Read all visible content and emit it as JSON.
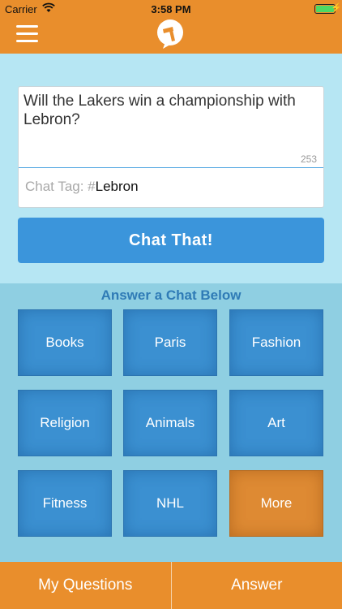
{
  "status_bar": {
    "carrier": "Carrier",
    "time": "3:58 PM",
    "battery_level": 1.0
  },
  "header": {
    "menu_icon": "hamburger-icon",
    "logo_icon": "chat-hammer-logo-icon"
  },
  "composer": {
    "question": "Will the Lakers win a championship with Lebron?",
    "char_count": "253",
    "tag_prefix": "Chat Tag: #",
    "tag_value": "Lebron"
  },
  "chat_button_label": "Chat That!",
  "answer_section": {
    "heading": "Answer a Chat Below",
    "categories": [
      "Books",
      "Paris",
      "Fashion",
      "Religion",
      "Animals",
      "Art",
      "Fitness",
      "NHL",
      "More"
    ]
  },
  "bottom_tabs": [
    "My Questions",
    "Answer"
  ],
  "colors": {
    "orange": "#e98e2c",
    "blue": "#3b95db",
    "light_blue": "#b6e6f3"
  }
}
